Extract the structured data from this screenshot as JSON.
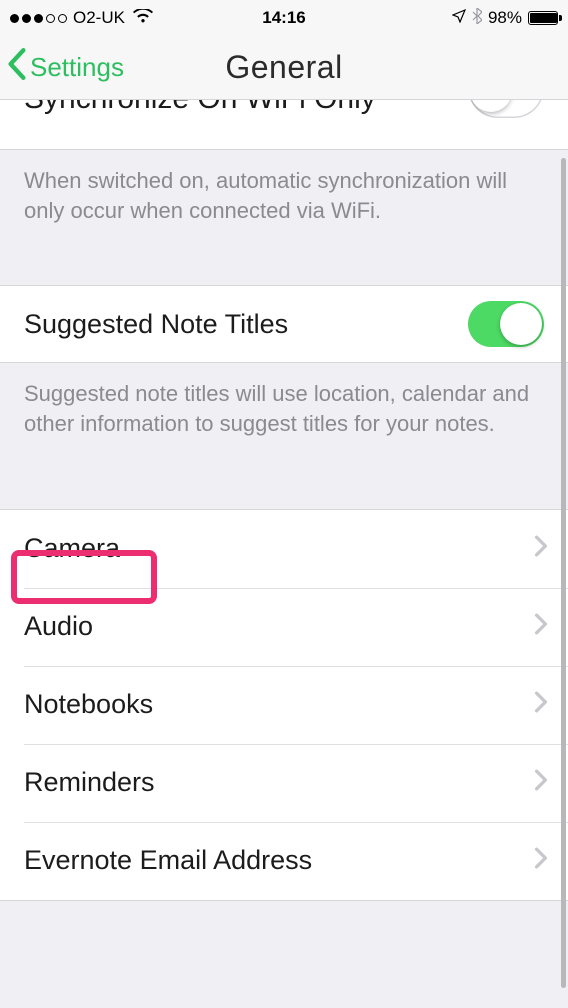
{
  "status": {
    "carrier": "O2-UK",
    "time": "14:16",
    "battery_percent": "98%"
  },
  "nav": {
    "back_label": "Settings",
    "title": "General"
  },
  "rows": {
    "wifi_sync_label": "Synchronize On WiFi Only",
    "wifi_sync_footer": "When switched on, automatic synchronization will only occur when connected via WiFi.",
    "suggested_titles_label": "Suggested Note Titles",
    "suggested_titles_footer": "Suggested note titles will use location, calendar and other information to suggest titles for your notes."
  },
  "nav_items": {
    "camera": "Camera",
    "audio": "Audio",
    "notebooks": "Notebooks",
    "reminders": "Reminders",
    "email": "Evernote Email Address"
  },
  "toggles": {
    "wifi_sync_on": false,
    "suggested_titles_on": true
  }
}
